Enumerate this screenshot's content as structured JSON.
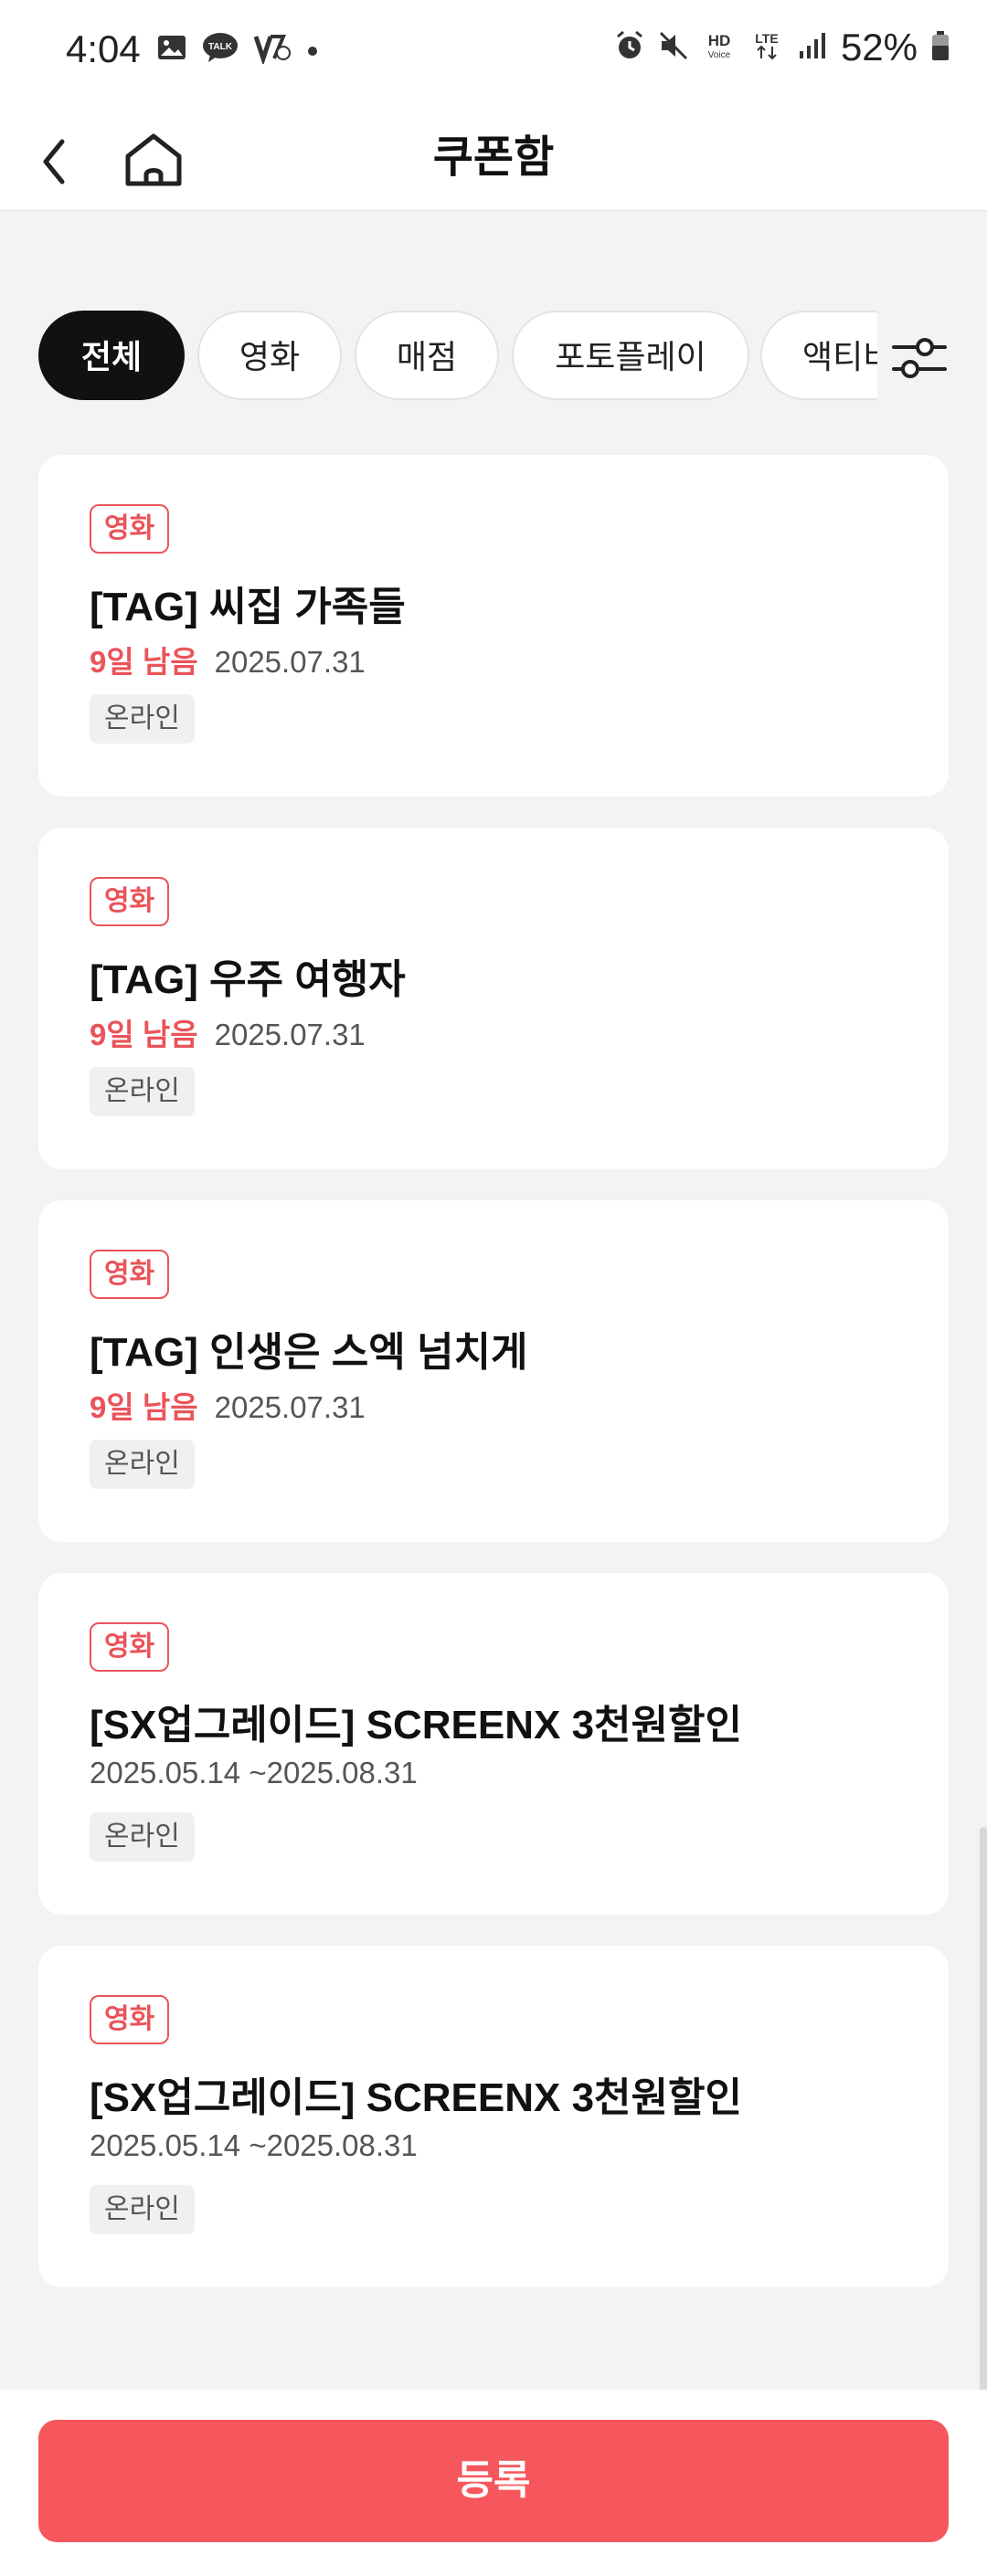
{
  "status_bar": {
    "time": "4:04",
    "battery": "52%",
    "left_icons": [
      "gallery-icon",
      "talk-icon",
      "vpn-icon",
      "dot-icon"
    ],
    "right_icons": [
      "alarm-icon",
      "mute-icon",
      "hd-voice-icon",
      "lte-icon",
      "signal-icon",
      "battery-icon"
    ],
    "talk_label": "TALK",
    "hd_label": "HD",
    "voice_label": "Voice",
    "lte_label": "LTE"
  },
  "header": {
    "title": "쿠폰함",
    "back_icon": "back-arrow-icon",
    "home_icon": "home-icon"
  },
  "filters": {
    "chips": [
      "전체",
      "영화",
      "매점",
      "포토플레이",
      "액티비"
    ],
    "active": "전체",
    "filter_icon": "sliders-icon"
  },
  "coupons": [
    {
      "category": "영화",
      "title": "[TAG] 씨집 가족들",
      "dday": "9일 남음",
      "date": "2025.07.31",
      "channel": "온라인"
    },
    {
      "category": "영화",
      "title": "[TAG] 우주 여행자",
      "dday": "9일 남음",
      "date": "2025.07.31",
      "channel": "온라인"
    },
    {
      "category": "영화",
      "title": "[TAG] 인생은 스엑 넘치게",
      "dday": "9일 남음",
      "date": "2025.07.31",
      "channel": "온라인"
    },
    {
      "category": "영화",
      "title": "[SX업그레이드] SCREENX 3천원할인",
      "dday": "",
      "date": "2025.05.14 ~2025.08.31",
      "channel": "온라인"
    },
    {
      "category": "영화",
      "title": "[SX업그레이드] SCREENX 3천원할인",
      "dday": "",
      "date": "2025.05.14 ~2025.08.31",
      "channel": "온라인"
    }
  ],
  "footer": {
    "register_label": "등록"
  },
  "colors": {
    "accent": "#f5575c",
    "badge": "#e9545a",
    "background": "#f3f3f3"
  }
}
